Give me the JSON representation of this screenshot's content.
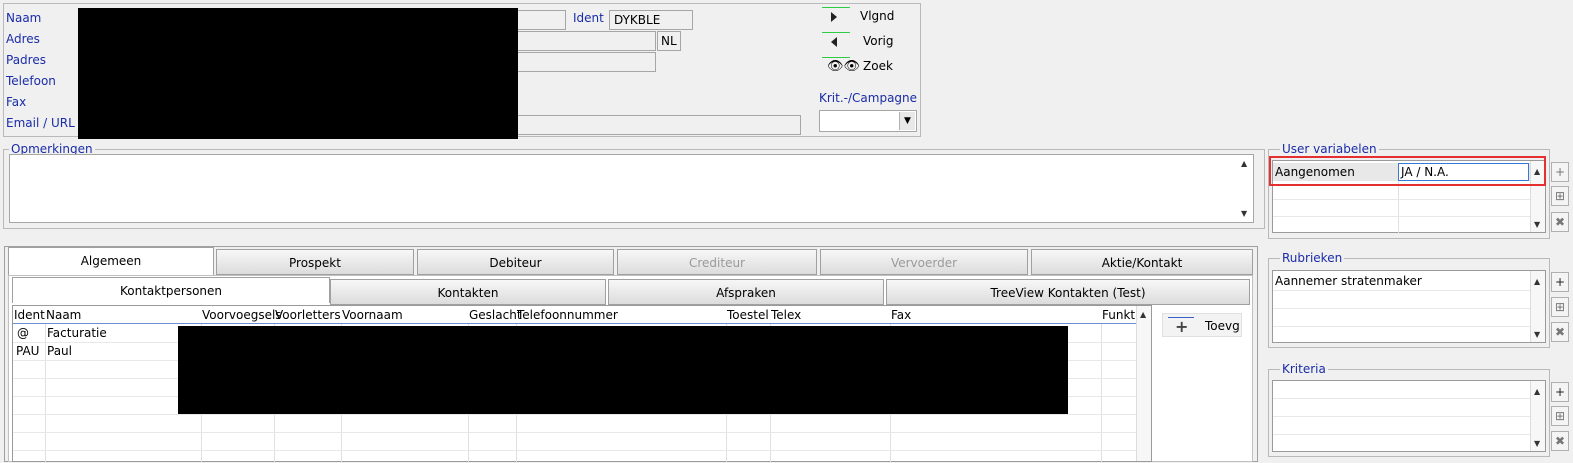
{
  "header": {
    "labels": {
      "naam": "Naam",
      "adres": "Adres",
      "padres": "Padres",
      "telefoon": "Telefoon",
      "fax": "Fax",
      "email": "Email / URL",
      "ident": "Ident"
    },
    "ident_value": "DYKBLE",
    "country_code": "NL",
    "nav": {
      "next": "Vlgnd",
      "prev": "Vorig",
      "search": "Zoek"
    },
    "krit_label": "Krit.-/Campagne",
    "krit_value": ""
  },
  "opmerkingen": {
    "title": "Opmerkingen",
    "value": ""
  },
  "tabs_main": [
    {
      "label": "Algemeen",
      "state": "active"
    },
    {
      "label": "Prospekt",
      "state": "normal"
    },
    {
      "label": "Debiteur",
      "state": "normal"
    },
    {
      "label": "Crediteur",
      "state": "disabled"
    },
    {
      "label": "Vervoerder",
      "state": "disabled"
    },
    {
      "label": "Aktie/Kontakt",
      "state": "normal"
    }
  ],
  "tabs_sub": [
    {
      "label": "Kontaktpersonen",
      "state": "active"
    },
    {
      "label": "Kontakten",
      "state": "normal"
    },
    {
      "label": "Afspraken",
      "state": "normal"
    },
    {
      "label": "TreeView Kontakten (Test)",
      "state": "normal"
    }
  ],
  "contacts_table": {
    "columns": [
      "Ident",
      "Naam",
      "Voorvoegsels",
      "Voorletters",
      "Voornaam",
      "Geslacht",
      "Telefoonnummer",
      "Toestel",
      "Telex",
      "Fax",
      "Funktie"
    ],
    "rows": [
      {
        "ident": "@",
        "naam": "Facturatie"
      },
      {
        "ident": "PAU",
        "naam": "Paul"
      }
    ],
    "add_button": "Toevg"
  },
  "user_variabelen": {
    "title": "User variabelen",
    "rows": [
      {
        "name": "Aangenomen",
        "value": "JA / N.A."
      }
    ]
  },
  "rubrieken": {
    "title": "Rubrieken",
    "rows": [
      "Aannemer stratenmaker"
    ]
  },
  "kriteria": {
    "title": "Kriteria",
    "rows": []
  }
}
